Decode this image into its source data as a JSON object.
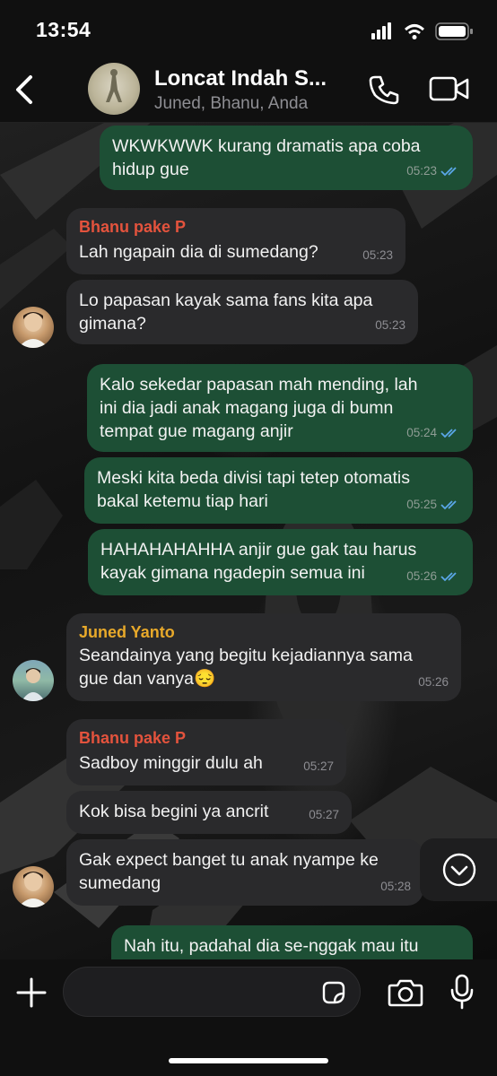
{
  "status_bar": {
    "time": "13:54"
  },
  "header": {
    "title": "Loncat Indah S...",
    "subtitle": "Juned, Bhanu, Anda"
  },
  "colors": {
    "outgoing": "#1d4f35",
    "incoming": "#2a2a2c",
    "bhanu": "#e4533d",
    "juned": "#e8a92a",
    "read_ticks": "#5aa7e8"
  },
  "messages": [
    {
      "dir": "out",
      "lines": [
        "WKWKWWK kurang dramatis apa coba",
        "hidup gue"
      ],
      "time": "05:23"
    },
    {
      "dir": "in",
      "sender": "Bhanu pake P",
      "lines": [
        "Lah ngapain dia di sumedang?"
      ],
      "time": "05:23"
    },
    {
      "dir": "in",
      "lines": [
        "Lo papasan kayak sama fans kita apa",
        "gimana?"
      ],
      "time": "05:23"
    },
    {
      "dir": "out",
      "lines": [
        "Kalo sekedar papasan mah mending, lah",
        "ini dia jadi anak magang juga di bumn",
        "tempat gue magang anjir"
      ],
      "time": "05:24"
    },
    {
      "dir": "out",
      "lines": [
        "Meski kita beda divisi tapi tetep otomatis",
        "bakal ketemu tiap hari"
      ],
      "time": "05:25"
    },
    {
      "dir": "out",
      "lines": [
        "HAHAHAHAHHA anjir gue gak tau harus",
        "kayak gimana ngadepin semua ini"
      ],
      "time": "05:26"
    },
    {
      "dir": "in",
      "sender": "Juned Yanto",
      "lines": [
        "Seandainya yang begitu kejadiannya sama",
        "gue dan vanya😔"
      ],
      "time": "05:26"
    },
    {
      "dir": "in",
      "sender": "Bhanu pake P",
      "lines": [
        "Sadboy minggir dulu ah"
      ],
      "time": "05:27"
    },
    {
      "dir": "in",
      "lines": [
        "Kok bisa begini ya ancrit"
      ],
      "time": "05:27"
    },
    {
      "dir": "in",
      "lines": [
        "Gak expect banget tu anak nyampe ke",
        "sumedang"
      ],
      "time": "05:28"
    },
    {
      "dir": "out",
      "lines": [
        "Nah itu, padahal dia se-nggak mau itu"
      ],
      "time": ""
    }
  ],
  "icons": [
    "back-chevron-icon",
    "phone-icon",
    "video-camera-icon",
    "scroll-down-icon",
    "plus-icon",
    "sticker-icon",
    "camera-icon",
    "microphone-icon"
  ]
}
